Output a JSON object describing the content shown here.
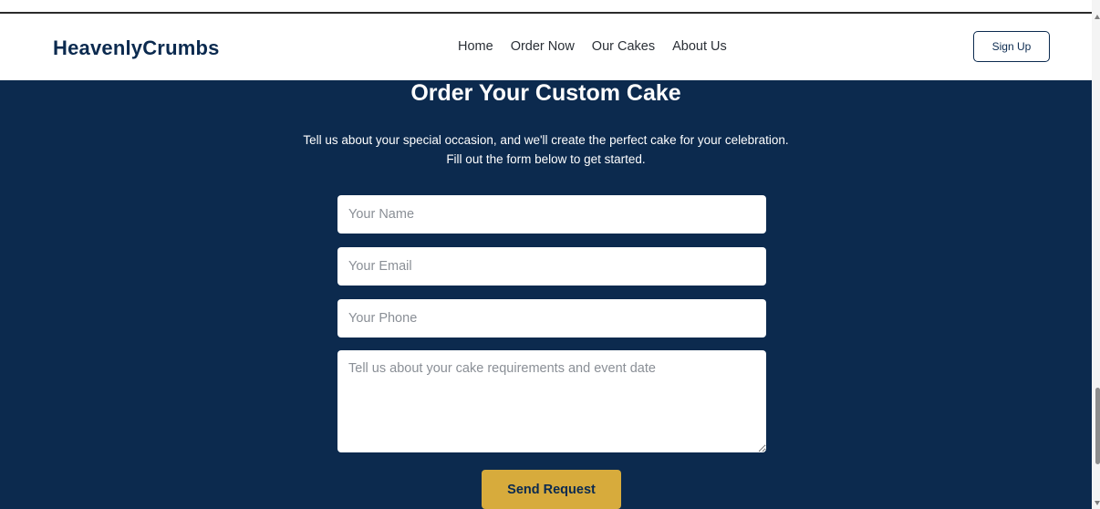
{
  "header": {
    "brand": "HeavenlyCrumbs",
    "nav": [
      {
        "label": "Home"
      },
      {
        "label": "Order Now"
      },
      {
        "label": "Our Cakes"
      },
      {
        "label": "About Us"
      }
    ],
    "signup_label": "Sign Up"
  },
  "order_section": {
    "title": "Order Your Custom Cake",
    "subtitle": "Tell us about your special occasion, and we'll create the perfect cake for your celebration. Fill out the form below to get started.",
    "form": {
      "name_placeholder": "Your Name",
      "email_placeholder": "Your Email",
      "phone_placeholder": "Your Phone",
      "message_placeholder": "Tell us about your cake requirements and event date",
      "submit_label": "Send Request"
    }
  },
  "colors": {
    "brand_navy": "#0b2a4f",
    "section_background": "#0c2a4e",
    "accent_gold": "#d7ab3c"
  },
  "icons": {
    "scroll_up": "scroll-up-arrow-icon",
    "scroll_down": "scroll-down-arrow-icon"
  }
}
